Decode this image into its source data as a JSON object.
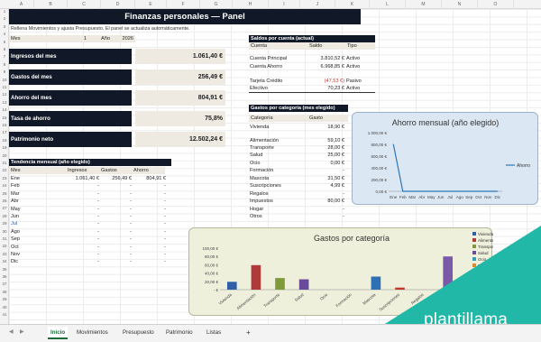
{
  "columns": [
    "A",
    "B",
    "C",
    "D",
    "E",
    "F",
    "G",
    "H",
    "I",
    "J",
    "K",
    "L",
    "M",
    "N",
    "O"
  ],
  "rows": [
    "1",
    "2",
    "3",
    "4",
    "5",
    "6",
    "7",
    "8",
    "9",
    "10",
    "11",
    "12",
    "13",
    "14",
    "15",
    "16",
    "17",
    "18",
    "19",
    "20",
    "21",
    "22",
    "23",
    "24",
    "25",
    "26",
    "27",
    "28",
    "29",
    "30",
    "31",
    "32",
    "33",
    "34",
    "35",
    "36",
    "37",
    "38",
    "39",
    "40",
    "41"
  ],
  "title": "Finanzas personales — Panel",
  "hint": "Rellena Movimientos y ajusta Presupuesto. El panel se actualiza automáticamente.",
  "selector": {
    "mes_label": "Mes",
    "mes_value": "1",
    "anio_label": "Año",
    "anio_value": "2026"
  },
  "kpis": [
    {
      "label": "Ingresos del mes",
      "value": "1.061,40 €"
    },
    {
      "label": "Gastos del mes",
      "value": "256,49 €"
    },
    {
      "label": "Ahorro del mes",
      "value": "804,91 €"
    },
    {
      "label": "Tasa de ahorro",
      "value": "75,8%"
    },
    {
      "label": "Patrimonio neto",
      "value": "12.502,24 €"
    }
  ],
  "saldos": {
    "title": "Saldos por cuenta (actual)",
    "headers": [
      "Cuenta",
      "Saldo",
      "Tipo"
    ],
    "rows": [
      {
        "cuenta": "Cuenta Principal",
        "saldo": "3.810,52 €",
        "tipo": "Activo"
      },
      {
        "cuenta": "Cuenta Ahorro",
        "saldo": "6.968,85 €",
        "tipo": "Activo"
      },
      {
        "cuenta": "",
        "saldo": "",
        "tipo": ""
      },
      {
        "cuenta": "Tarjeta Crédito",
        "saldo": "(47,53 €)",
        "tipo": "Pasivo"
      },
      {
        "cuenta": "Efectivo",
        "saldo": "70,23 €",
        "tipo": "Activo"
      }
    ]
  },
  "gastos_cat": {
    "title": "Gastos por categoría (mes elegido)",
    "headers": [
      "Categoría",
      "Gasto"
    ],
    "rows": [
      {
        "cat": "Vivienda",
        "gasto": "18,90 €"
      },
      {
        "cat": "",
        "gasto": ""
      },
      {
        "cat": "Alimentación",
        "gasto": "59,10 €"
      },
      {
        "cat": "Transporte",
        "gasto": "28,00 €"
      },
      {
        "cat": "Salud",
        "gasto": "25,00 €"
      },
      {
        "cat": "Ocio",
        "gasto": "0,00 €"
      },
      {
        "cat": "Formación",
        "gasto": "-"
      },
      {
        "cat": "Mascota",
        "gasto": "31,50 €"
      },
      {
        "cat": "Suscripciones",
        "gasto": "4,99 €"
      },
      {
        "cat": "Regalos",
        "gasto": "-"
      },
      {
        "cat": "Impuestos",
        "gasto": "80,00 €"
      },
      {
        "cat": "Hogar",
        "gasto": "-"
      },
      {
        "cat": "Otros",
        "gasto": "-"
      }
    ]
  },
  "tendencia": {
    "title": "Tendencia mensual (año elegido)",
    "headers": [
      "Mes",
      "Ingresos",
      "Gastos",
      "Ahorro"
    ],
    "rows": [
      {
        "mes": "Ene",
        "ing": "1.061,40 €",
        "gas": "256,49 €",
        "aho": "804,91 €"
      },
      {
        "mes": "Feb",
        "ing": "-",
        "gas": "-",
        "aho": "-"
      },
      {
        "mes": "Mar",
        "ing": "-",
        "gas": "-",
        "aho": "-"
      },
      {
        "mes": "Abr",
        "ing": "-",
        "gas": "-",
        "aho": "-"
      },
      {
        "mes": "May",
        "ing": "-",
        "gas": "-",
        "aho": "-"
      },
      {
        "mes": "Jun",
        "ing": "-",
        "gas": "-",
        "aho": "-"
      },
      {
        "mes": "Jul",
        "ing": "-",
        "gas": "-",
        "aho": "-"
      },
      {
        "mes": "Ago",
        "ing": "-",
        "gas": "-",
        "aho": "-"
      },
      {
        "mes": "Sep",
        "ing": "-",
        "gas": "-",
        "aho": "-"
      },
      {
        "mes": "Oct",
        "ing": "-",
        "gas": "-",
        "aho": "-"
      },
      {
        "mes": "Nov",
        "ing": "-",
        "gas": "-",
        "aho": "-"
      },
      {
        "mes": "Dic",
        "ing": "-",
        "gas": "-",
        "aho": "-"
      }
    ]
  },
  "chart_data": [
    {
      "type": "line",
      "title": "Ahorro mensual (año elegido)",
      "categories": [
        "Ene",
        "Feb",
        "Mar",
        "Abr",
        "May",
        "Jun",
        "Jul",
        "Ago",
        "Sep",
        "Oct",
        "Nov",
        "Dic"
      ],
      "series": [
        {
          "name": "Ahorro",
          "values": [
            804.91,
            0,
            0,
            0,
            0,
            0,
            0,
            0,
            0,
            0,
            0,
            0
          ],
          "color": "#2e75b6"
        }
      ],
      "ylim": [
        0,
        1000
      ],
      "yticks": [
        "1.000,00 €",
        "800,00 €",
        "600,00 €",
        "400,00 €",
        "200,00 €",
        "0,00 €"
      ],
      "legend": "right"
    },
    {
      "type": "bar",
      "title": "Gastos por categoría",
      "categories": [
        "Vivienda",
        "Alimentación",
        "Transporte",
        "Salud",
        "Ocio",
        "Formación",
        "Mascota",
        "Suscripciones",
        "Regalos",
        "Impuestos"
      ],
      "values": [
        18.9,
        59.1,
        28,
        25,
        0,
        0,
        31.5,
        4.99,
        0,
        80
      ],
      "colors": [
        "#2e5fa8",
        "#b03a3a",
        "#7f9a3a",
        "#6a4a9a",
        "#2fa0b5",
        "#e0892c",
        "#2e6fb5",
        "#c0392b",
        "#8fae4a",
        "#7a5aa8"
      ],
      "legend_items": [
        "Vivienda",
        "Alimentación",
        "Transporte",
        "Salud",
        "Ocio",
        "Formación",
        "Mascota",
        "Suscripciones"
      ],
      "yticks": [
        "100,00 €",
        "80,00 €",
        "60,00 €",
        "40,00 €",
        "20,00 €",
        "- €"
      ],
      "ylim": [
        0,
        100
      ],
      "legend": "right"
    }
  ],
  "tabs": [
    "Inicio",
    "Movimientos",
    "Presupuesto",
    "Patrimonio",
    "Listas",
    "+"
  ],
  "brand": "plantillama",
  "colors": {
    "dark": "#111827",
    "beige": "#efeae1",
    "accent_green": "#1e6b3a",
    "brand_teal": "#22b8a8"
  }
}
